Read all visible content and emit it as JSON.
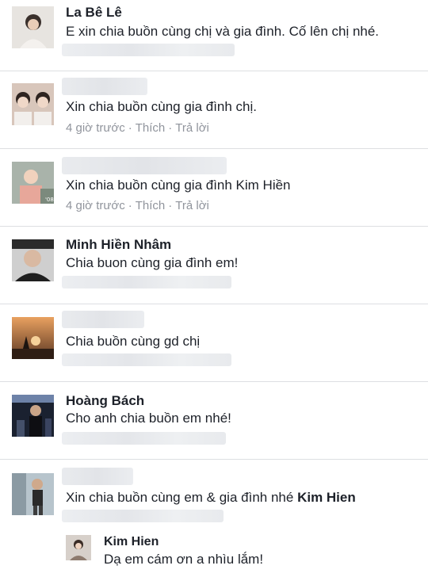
{
  "comments": [
    {
      "name": "La Bê Lê",
      "text": "E xin chia buồn cùng chị và gia đình. Cố lên chị nhé."
    },
    {
      "name": "",
      "text": "Xin chia buồn cùng gia đình chị.",
      "time": "4 giờ trước",
      "like": "Thích",
      "reply": "Trả lời"
    },
    {
      "name": "",
      "text": "Xin chia buồn cùng gia đình Kim Hiền",
      "time": "4 giờ trước",
      "like": "Thích",
      "reply": "Trả lời"
    },
    {
      "name": "Minh Hiền Nhâm",
      "text": "Chia buon cùng gia đình em!"
    },
    {
      "name": "",
      "text": "Chia buồn cùng gd chị"
    },
    {
      "name": "Hoàng Bách",
      "text": "Cho anh chia buồn em nhé!"
    },
    {
      "name": "",
      "text": "Xin chia buồn cùng em & gia đình nhé",
      "tag": "Kim Hien"
    }
  ],
  "reply": {
    "name": "Kim Hien",
    "text": "Dạ em cám ơn a nhìu lắm!"
  },
  "colors": {
    "text": "#1d2129",
    "meta": "#90949c",
    "divider": "#dddfe2"
  }
}
